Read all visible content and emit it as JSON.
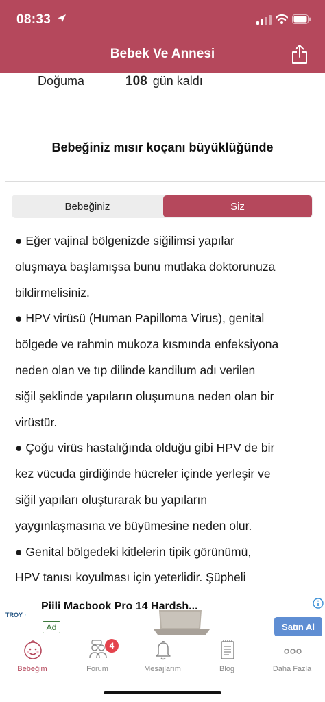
{
  "status_bar": {
    "time": "08:33"
  },
  "nav": {
    "title": "Bebek Ve Annesi",
    "share_icon": "share-icon"
  },
  "countdown": {
    "label": "Doğuma",
    "days": "108",
    "suffix": "gün kaldı"
  },
  "size_heading": "Bebeğiniz mısır koçanı büyüklüğünde",
  "segment": {
    "left_label": "Bebeğiniz",
    "right_label": "Siz",
    "selected": "Siz"
  },
  "article": {
    "lines": [
      "● Eğer vajinal bölgenizde siğilimsi yapılar",
      "oluşmaya başlamışsa bunu mutlaka doktorunuza",
      "bildirmelisiniz.",
      "● HPV virüsü (Human Papilloma Virus), genital",
      "bölgede ve rahmin mukoza kısmında enfeksiyona",
      "neden olan ve tıp dilinde kandilum adı verilen",
      "siğil şeklinde yapıların oluşumuna neden olan bir",
      "virüstür.",
      "● Çoğu virüs hastalığında olduğu gibi HPV de bir",
      "kez vücuda girdiğinde hücreler içinde yerleşir ve",
      "siğil yapıları oluşturarak bu yapıların",
      "yaygınlaşmasına ve büyümesine neden olur.",
      "● Genital bölgedeki kitlelerin tipik görünümü,",
      "HPV tanısı koyulması için yeterlidir. Şüpheli"
    ]
  },
  "ad": {
    "advertiser_logo": "TROY",
    "title": "Piili Macbook Pro 14 Hardsh...",
    "badge": "Ad",
    "cta": "Satın Al"
  },
  "tabbar": {
    "tabs": [
      {
        "label": "Bebeğim",
        "icon": "baby-face-icon",
        "active": true
      },
      {
        "label": "Forum",
        "icon": "forum-people-icon",
        "badge": "4"
      },
      {
        "label": "Mesajlarım",
        "icon": "bell-icon"
      },
      {
        "label": "Blog",
        "icon": "notepad-icon"
      },
      {
        "label": "Daha Fazla",
        "icon": "more-dots-icon"
      }
    ]
  },
  "colors": {
    "brand": "#b5485c",
    "badge_red": "#e4434d",
    "cta_blue": "#5f8ed3",
    "tab_inactive": "#8a8a8a"
  }
}
